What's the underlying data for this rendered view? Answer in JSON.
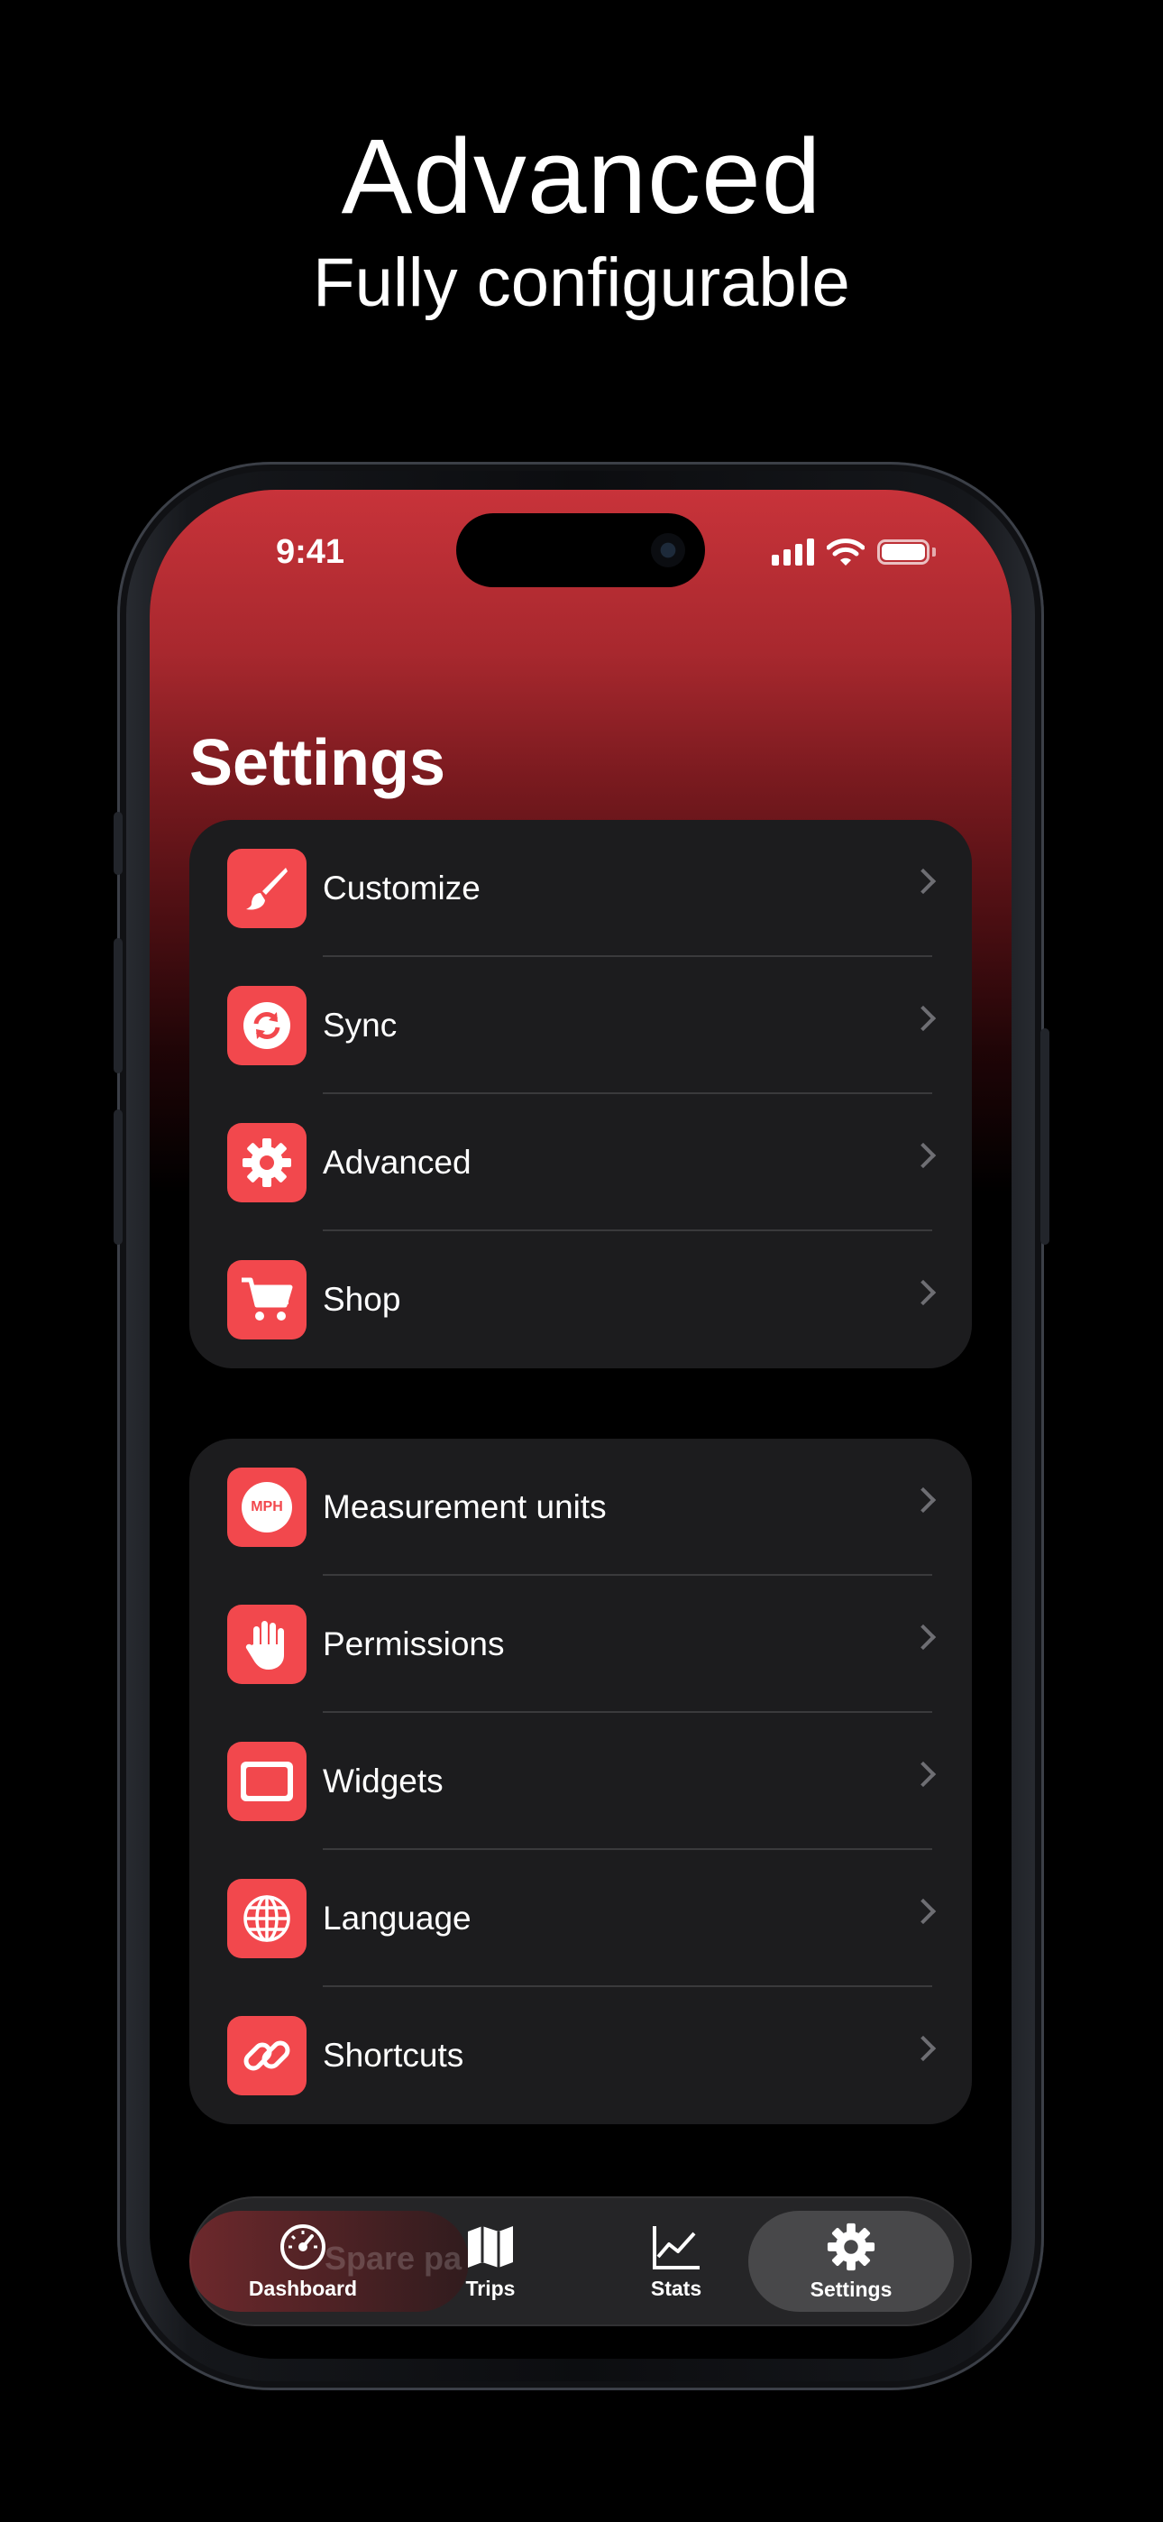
{
  "headline": {
    "title": "Advanced",
    "subtitle": "Fully configurable"
  },
  "status_bar": {
    "time": "9:41"
  },
  "page_title": "Settings",
  "groups": [
    {
      "items": [
        {
          "label": "Customize",
          "icon": "paintbrush-icon"
        },
        {
          "label": "Sync",
          "icon": "sync-icon"
        },
        {
          "label": "Advanced",
          "icon": "gear-icon"
        },
        {
          "label": "Shop",
          "icon": "cart-icon"
        }
      ]
    },
    {
      "items": [
        {
          "label": "Measurement units",
          "icon": "mph-icon",
          "icon_text": "MPH"
        },
        {
          "label": "Permissions",
          "icon": "hand-icon"
        },
        {
          "label": "Widgets",
          "icon": "widget-icon"
        },
        {
          "label": "Language",
          "icon": "globe-icon"
        },
        {
          "label": "Shortcuts",
          "icon": "link-icon"
        }
      ]
    }
  ],
  "tab_bar": {
    "behind_text": "Spare pa",
    "tabs": [
      {
        "label": "Dashboard",
        "icon": "speedometer-icon"
      },
      {
        "label": "Trips",
        "icon": "map-icon"
      },
      {
        "label": "Stats",
        "icon": "chart-icon"
      },
      {
        "label": "Settings",
        "icon": "gear-icon",
        "active": true
      }
    ]
  },
  "colors": {
    "accent": "#f2484d",
    "card": "#1c1c1e",
    "gradient_top": "#c8333a"
  }
}
